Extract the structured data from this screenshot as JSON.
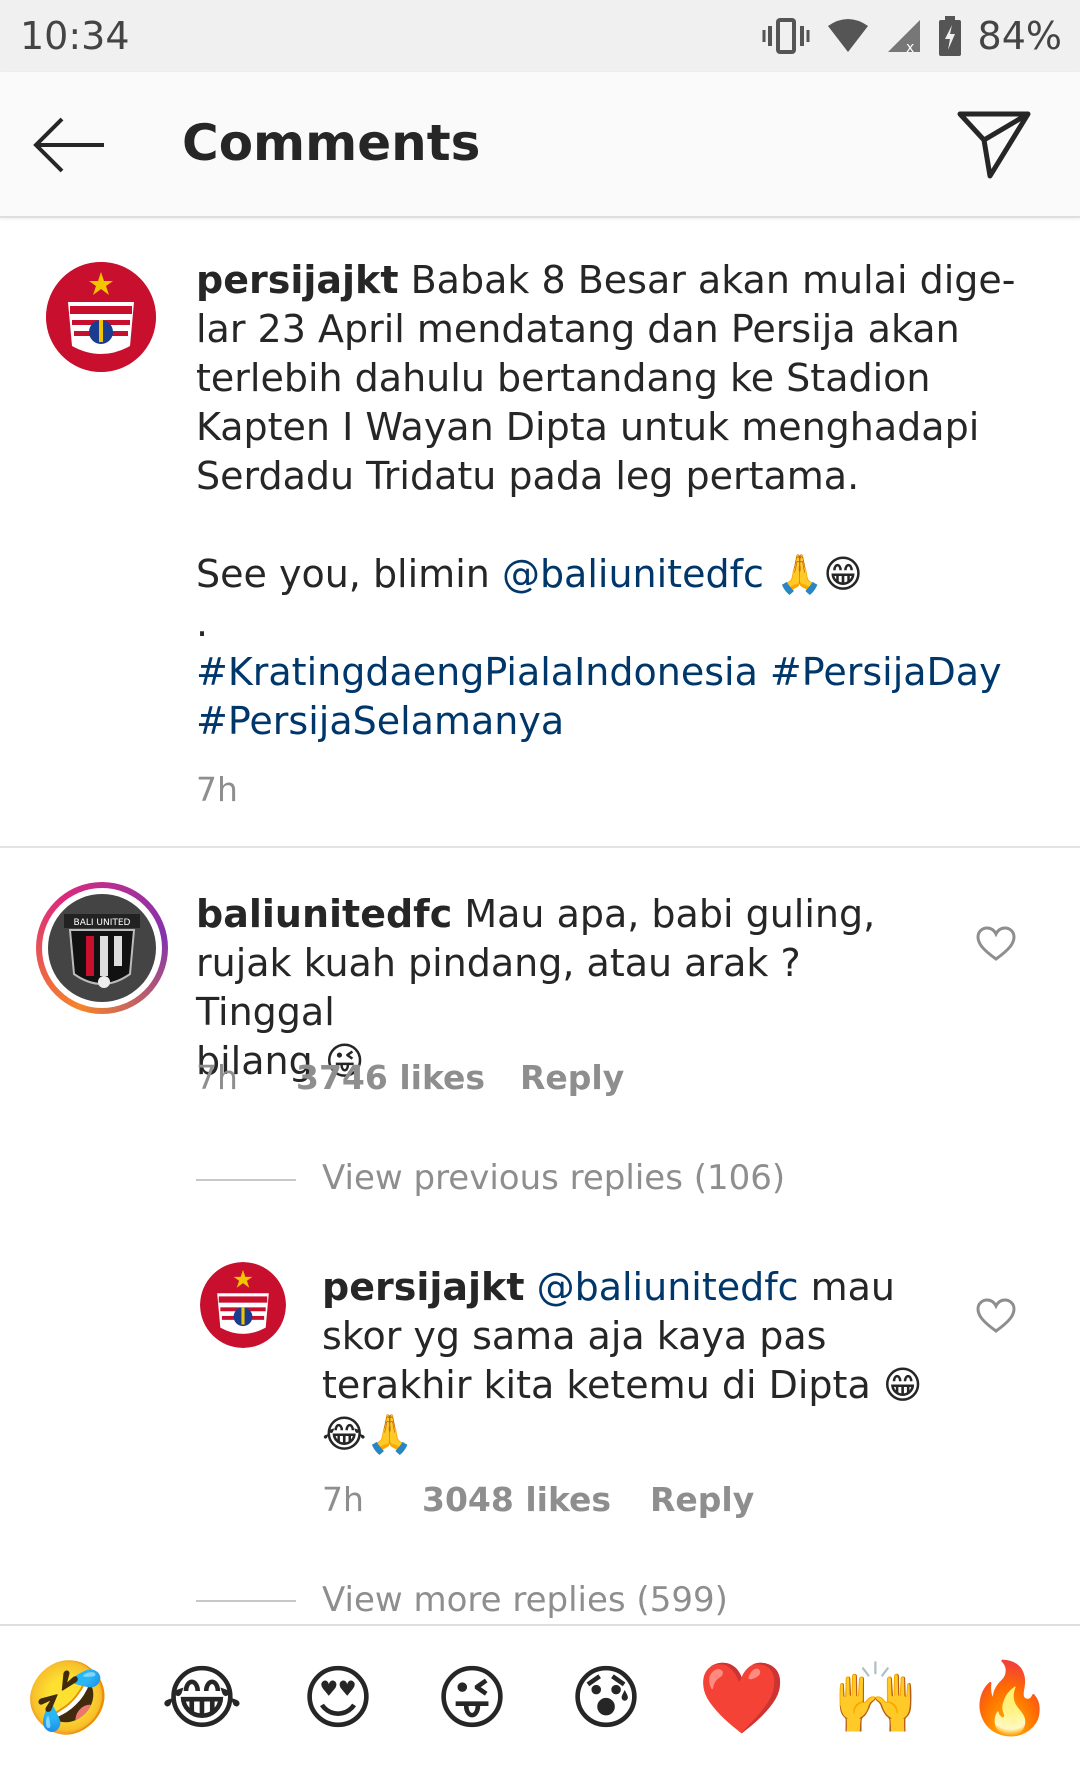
{
  "status_bar": {
    "time": "10:34",
    "battery": "84%"
  },
  "header": {
    "title": "Comments"
  },
  "post": {
    "username": "persijajkt",
    "lines": [
      "Babak 8 Besar akan mulai dige-",
      "lar 23 April mendatang dan Persija akan",
      "terlebih dahulu bertandang ke Stadion",
      "Kapten I Wayan Dipta untuk menghadapi",
      "Serdadu Tridatu pada leg pertama."
    ],
    "see_you": "See you, blimin",
    "mention": "@baliunitedfc",
    "emojis": "🙏😁",
    "dot": ".",
    "hashtags_line1": "#KratingdaengPialaIndonesia #PersijaDay",
    "hashtags_line2": "#PersijaSelamanya",
    "time": "7h"
  },
  "comments": [
    {
      "username": "baliunitedfc",
      "line1": "Mau apa, babi guling,",
      "line2": "rujak kuah pindang, atau arak ? Tinggal",
      "line3": "bilang",
      "emoji": "😜",
      "time": "7h",
      "likes": "3746 likes",
      "reply": "Reply",
      "avatar_label": "BALI UNITED"
    }
  ],
  "view_previous": "View previous replies (106)",
  "reply": {
    "username": "persijajkt",
    "mention": "@baliunitedfc",
    "line1": "mau",
    "line2": "skor yg sama aja kaya pas",
    "line3": "terakhir kita ketemu di Dipta",
    "emoji1": "😁",
    "emoji2": "😂🙏",
    "time": "7h",
    "likes": "3048 likes",
    "reply": "Reply"
  },
  "view_more": "View more replies (599)",
  "emoji_bar": [
    "🤣",
    "😂",
    "😍",
    "😜",
    "😰",
    "❤️",
    "🙌",
    "🔥"
  ],
  "colors": {
    "link": "#00376b",
    "persija_red": "#c8102e",
    "ig_ring_orange": "#f58529",
    "ig_ring_pink": "#dd2a7b"
  }
}
